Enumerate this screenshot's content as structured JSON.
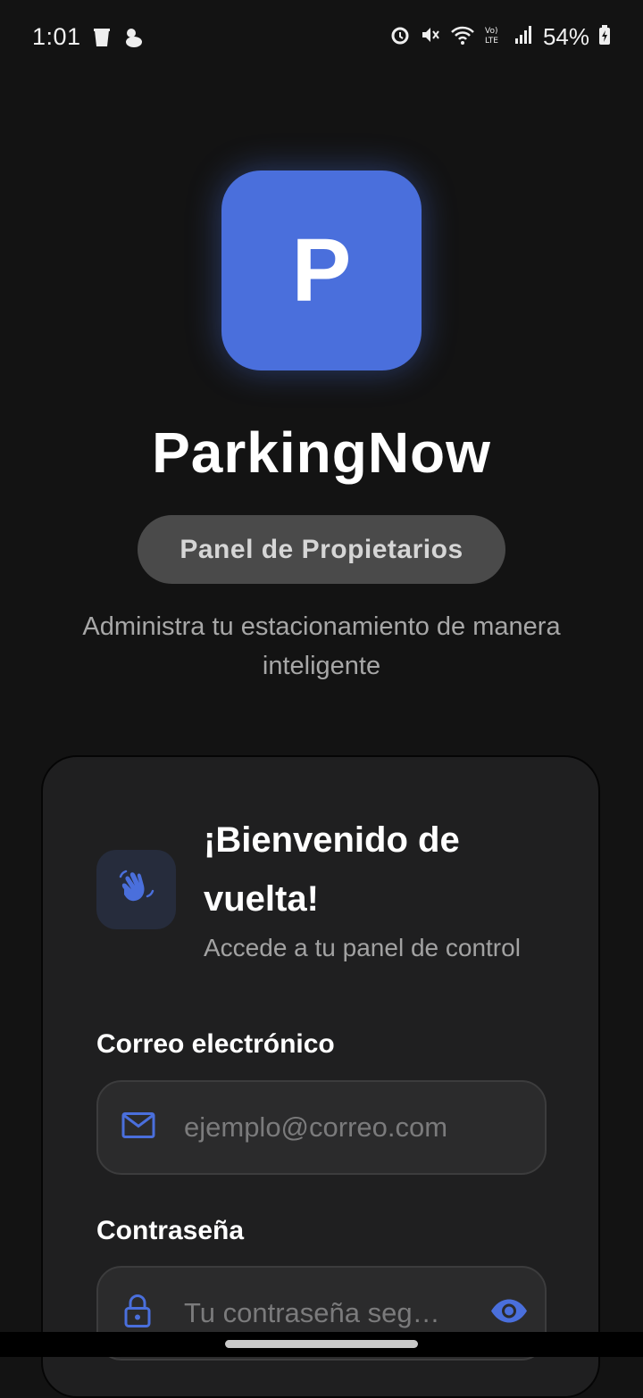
{
  "status_bar": {
    "time": "1:01",
    "battery": "54%",
    "icons": [
      "trash-icon",
      "bird-icon",
      "alarm-icon",
      "mute-icon",
      "wifi-icon",
      "volte-icon",
      "signal-icon",
      "battery-charging-icon"
    ]
  },
  "app": {
    "logo_letter": "P",
    "name": "ParkingNow",
    "badge": "Panel de Propietarios",
    "tagline": "Administra tu estacionamiento de manera inteligente"
  },
  "login_card": {
    "title": "¡Bienvenido de vuelta!",
    "subtitle": "Accede a tu panel de control",
    "email": {
      "label": "Correo electrónico",
      "placeholder": "ejemplo@correo.com",
      "value": ""
    },
    "password": {
      "label": "Contraseña",
      "placeholder": "Tu contraseña seg…",
      "value": ""
    }
  },
  "colors": {
    "background": "#131313",
    "accent": "#4a6fdc",
    "card": "#1f1f20",
    "input": "#2b2b2c",
    "pill": "#4a4a4a"
  }
}
